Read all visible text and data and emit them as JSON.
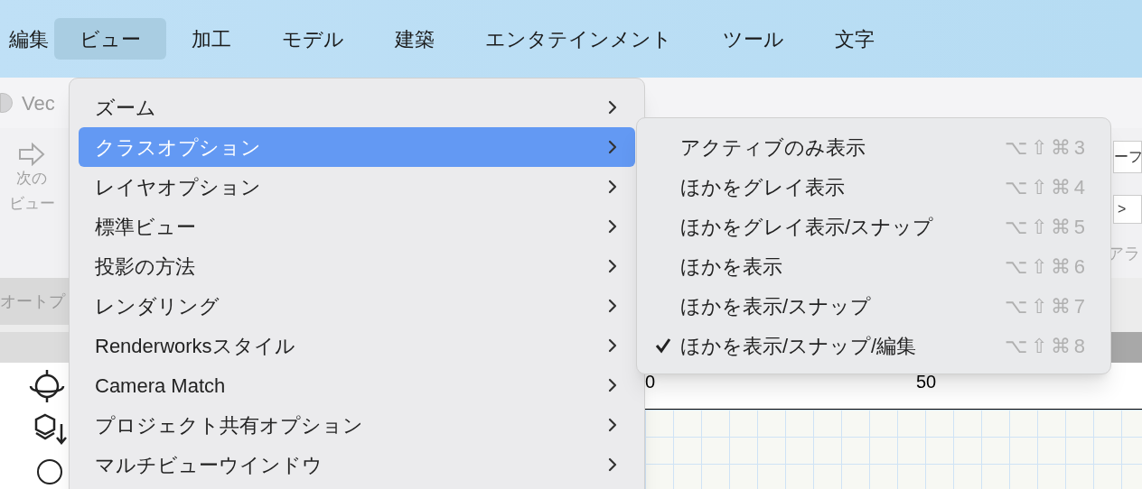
{
  "menu_bar": [
    {
      "label": "編集",
      "selected": false
    },
    {
      "label": "ビュー",
      "selected": true
    },
    {
      "label": "加工",
      "selected": false
    },
    {
      "label": "モデル",
      "selected": false
    },
    {
      "label": "建築",
      "selected": false
    },
    {
      "label": "エンタテインメント",
      "selected": false
    },
    {
      "label": "ツール",
      "selected": false
    },
    {
      "label": "文字",
      "selected": false
    }
  ],
  "background": {
    "window_title": "Vec",
    "toolbar_button": [
      "次の",
      "ビュー"
    ],
    "panel_label": "オートプ",
    "right_field": "ーフ",
    "right_field_2": ">",
    "right_label": "アラ",
    "ruler_labels": [
      "0",
      "50"
    ]
  },
  "view_menu": [
    {
      "label": "ズーム",
      "selected": false
    },
    {
      "label": "クラスオプション",
      "selected": true
    },
    {
      "label": "レイヤオプション",
      "selected": false
    },
    {
      "label": "標準ビュー",
      "selected": false
    },
    {
      "label": "投影の方法",
      "selected": false
    },
    {
      "label": "レンダリング",
      "selected": false
    },
    {
      "label": "Renderworksスタイル",
      "selected": false
    },
    {
      "label": "Camera Match",
      "selected": false
    },
    {
      "label": "プロジェクト共有オプション",
      "selected": false
    },
    {
      "label": "マルチビューウインドウ",
      "selected": false
    }
  ],
  "submenu": [
    {
      "label": "アクティブのみ表示",
      "shortcut": "⌥⇧⌘3",
      "checked": false
    },
    {
      "label": "ほかをグレイ表示",
      "shortcut": "⌥⇧⌘4",
      "checked": false
    },
    {
      "label": "ほかをグレイ表示/スナップ",
      "shortcut": "⌥⇧⌘5",
      "checked": false
    },
    {
      "label": "ほかを表示",
      "shortcut": "⌥⇧⌘6",
      "checked": false
    },
    {
      "label": "ほかを表示/スナップ",
      "shortcut": "⌥⇧⌘7",
      "checked": false
    },
    {
      "label": "ほかを表示/スナップ/編集",
      "shortcut": "⌥⇧⌘8",
      "checked": true
    }
  ]
}
